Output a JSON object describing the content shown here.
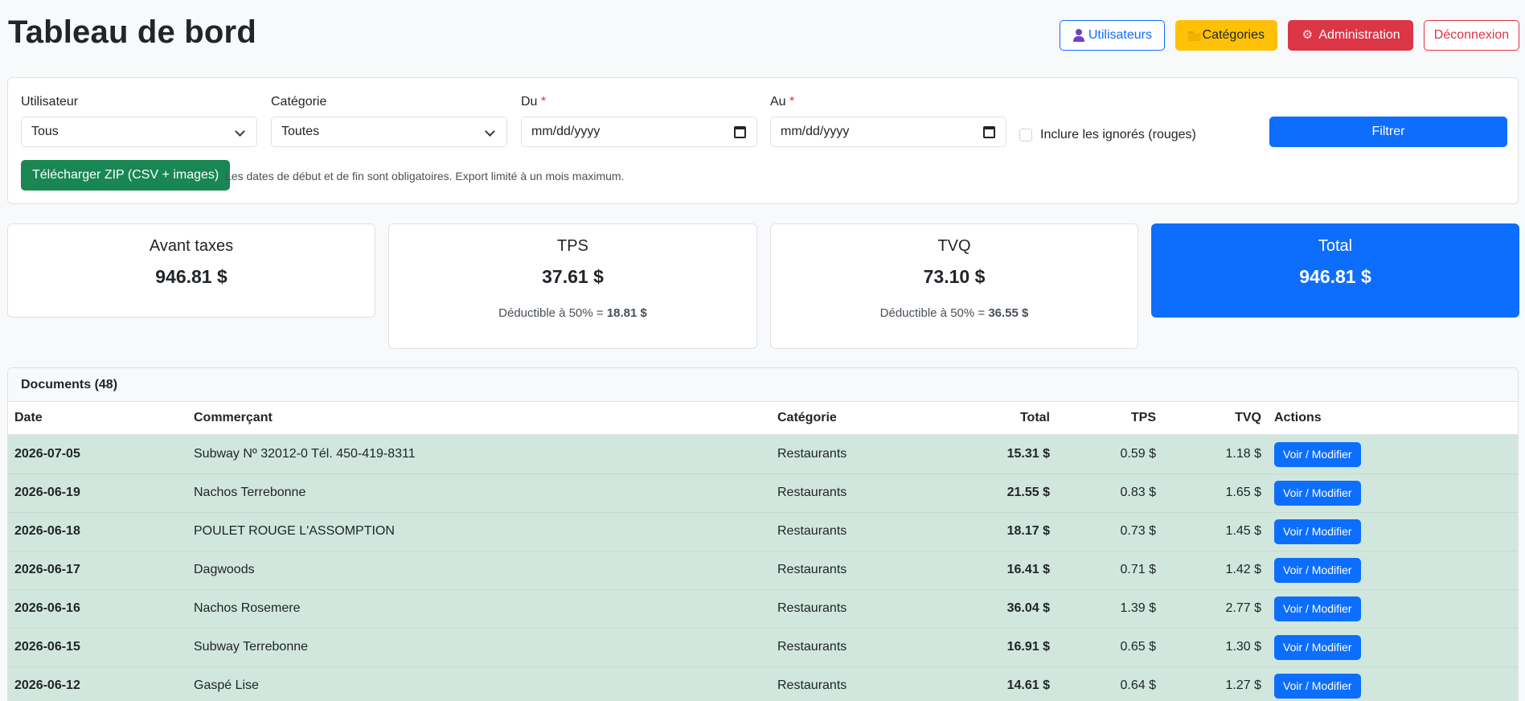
{
  "header": {
    "title": "Tableau de bord",
    "buttons": {
      "users": "Utilisateurs",
      "categories": "Catégories",
      "admin": "Administration",
      "logout": "Déconnexion"
    }
  },
  "filters": {
    "user_label": "Utilisateur",
    "user_value": "Tous",
    "category_label": "Catégorie",
    "category_value": "Toutes",
    "from_label": "Du",
    "from_value": "mm/dd/yyyy",
    "to_label": "Au",
    "to_value": "mm/dd/yyyy",
    "required_mark": "*",
    "include_ignored_label": "Inclure les ignorés (rouges)",
    "filter_button": "Filtrer",
    "zip_button": "Télécharger ZIP (CSV + images)",
    "help_text": "Les dates de début et de fin sont obligatoires. Export limité à un mois maximum."
  },
  "stats": {
    "pretax": {
      "title": "Avant taxes",
      "value": "946.81 $"
    },
    "tps": {
      "title": "TPS",
      "value": "37.61 $",
      "note_prefix": "Déductible à 50% = ",
      "note_value": "18.81 $"
    },
    "tvq": {
      "title": "TVQ",
      "value": "73.10 $",
      "note_prefix": "Déductible à 50% = ",
      "note_value": "36.55 $"
    },
    "total": {
      "title": "Total",
      "value": "946.81 $"
    }
  },
  "documents": {
    "title": "Documents (48)",
    "columns": [
      "Date",
      "Commerçant",
      "Catégorie",
      "Total",
      "TPS",
      "TVQ",
      "Actions"
    ],
    "action_label": "Voir / Modifier",
    "rows": [
      {
        "date": "2026-07-05",
        "merchant": "Subway Nº 32012-0 Tél. 450-419-8311",
        "category": "Restaurants",
        "total": "15.31 $",
        "tps": "0.59 $",
        "tvq": "1.18 $"
      },
      {
        "date": "2026-06-19",
        "merchant": "Nachos Terrebonne",
        "category": "Restaurants",
        "total": "21.55 $",
        "tps": "0.83 $",
        "tvq": "1.65 $"
      },
      {
        "date": "2026-06-18",
        "merchant": "POULET ROUGE L'ASSOMPTION",
        "category": "Restaurants",
        "total": "18.17 $",
        "tps": "0.73 $",
        "tvq": "1.45 $"
      },
      {
        "date": "2026-06-17",
        "merchant": "Dagwoods",
        "category": "Restaurants",
        "total": "16.41 $",
        "tps": "0.71 $",
        "tvq": "1.42 $"
      },
      {
        "date": "2026-06-16",
        "merchant": "Nachos Rosemere",
        "category": "Restaurants",
        "total": "36.04 $",
        "tps": "1.39 $",
        "tvq": "2.77 $"
      },
      {
        "date": "2026-06-15",
        "merchant": "Subway Terrebonne",
        "category": "Restaurants",
        "total": "16.91 $",
        "tps": "0.65 $",
        "tvq": "1.30 $"
      },
      {
        "date": "2026-06-12",
        "merchant": "Gaspé Lise",
        "category": "Restaurants",
        "total": "14.61 $",
        "tps": "0.64 $",
        "tvq": "1.27 $"
      }
    ]
  }
}
